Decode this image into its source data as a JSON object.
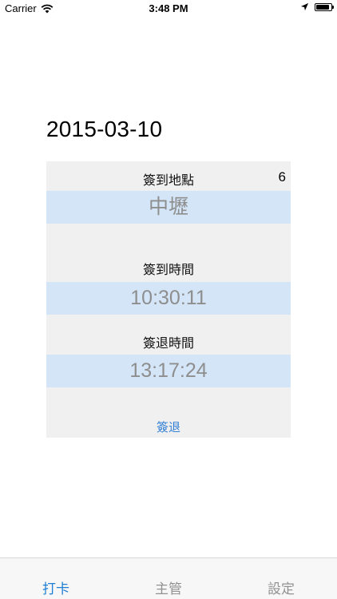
{
  "status_bar": {
    "carrier": "Carrier",
    "time": "3:48 PM",
    "battery_level": 0.9
  },
  "date": "2015-03-10",
  "checkin": {
    "location_label": "簽到地點",
    "location_count": "6",
    "location_value": "中壢",
    "checkin_time_label": "簽到時間",
    "checkin_time_value": "10:30:11",
    "checkout_time_label": "簽退時間",
    "checkout_time_value": "13:17:24",
    "action_label": "簽退"
  },
  "tabs": [
    {
      "label": "打卡",
      "active": true
    },
    {
      "label": "主管",
      "active": false
    },
    {
      "label": "設定",
      "active": false
    }
  ],
  "colors": {
    "accent": "#1f7fd4",
    "value_band": "#d3e5f7",
    "card_bg": "#f0f0f0"
  }
}
